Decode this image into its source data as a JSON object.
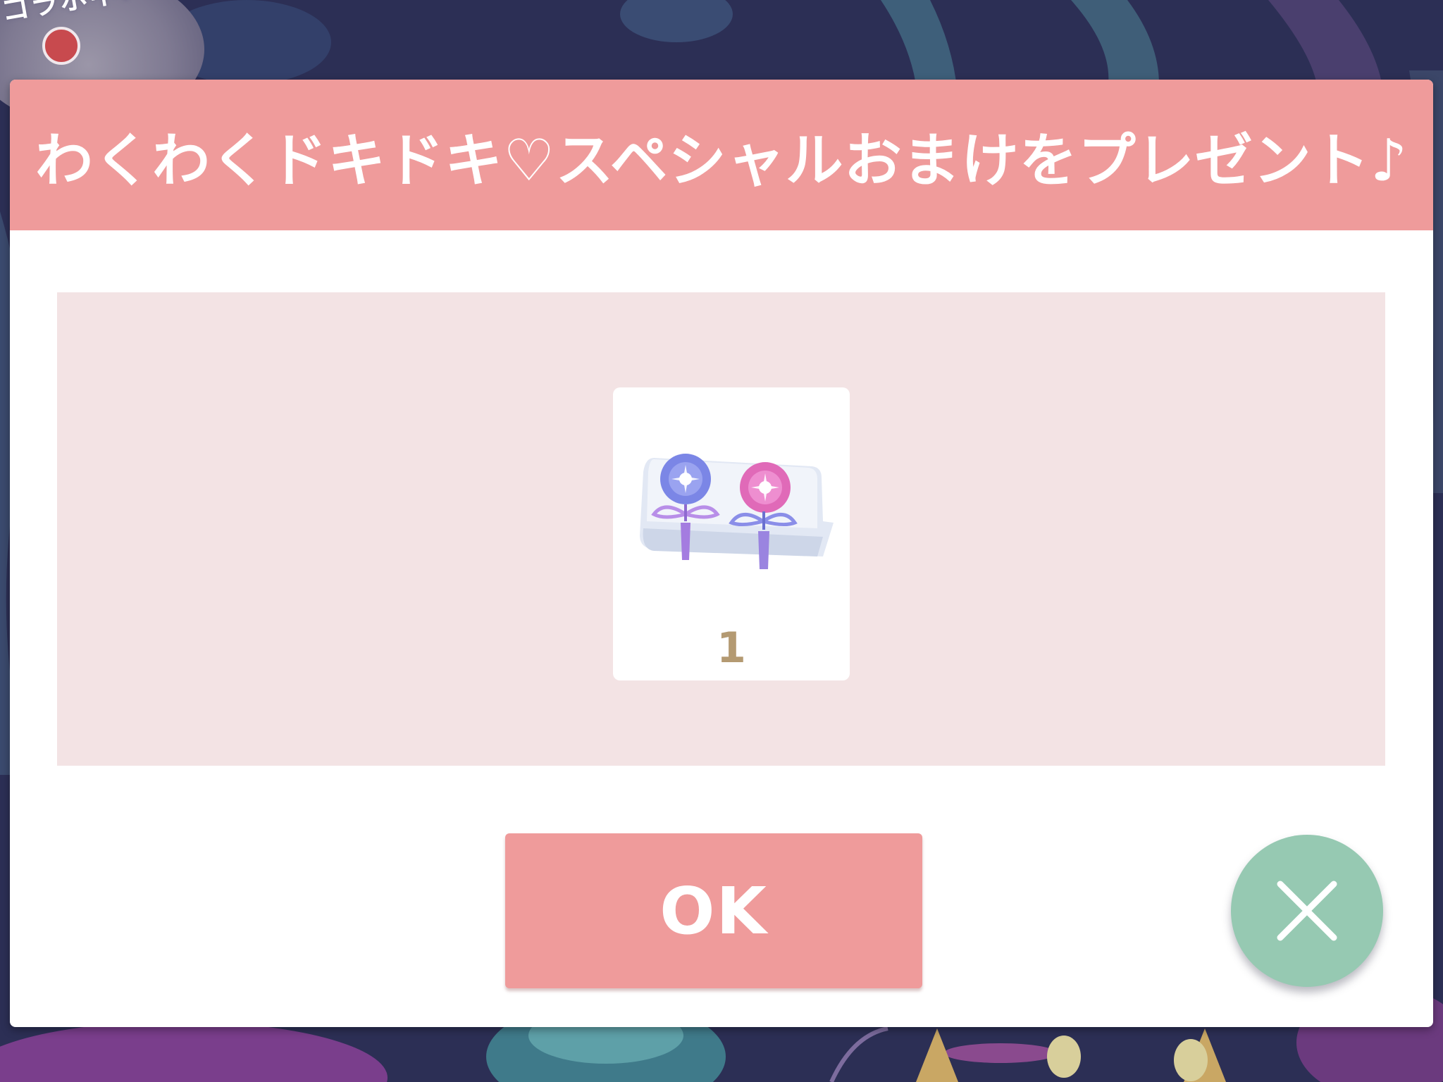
{
  "background": {
    "collab_badge_text": "コラボ中!"
  },
  "dialog": {
    "title": "わくわくドキドキ♡スペシャルおまけをプレゼント♪",
    "reward": {
      "icon": "morning-glory-hairpins-icon",
      "quantity": "1"
    },
    "ok_label": "OK",
    "close_icon": "close-icon"
  },
  "colors": {
    "header": "#ef9b9b",
    "ok_button": "#ef9b9b",
    "close_button": "#96c9b2",
    "reward_panel": "#f3e3e4",
    "quantity_text": "#b49a72"
  }
}
